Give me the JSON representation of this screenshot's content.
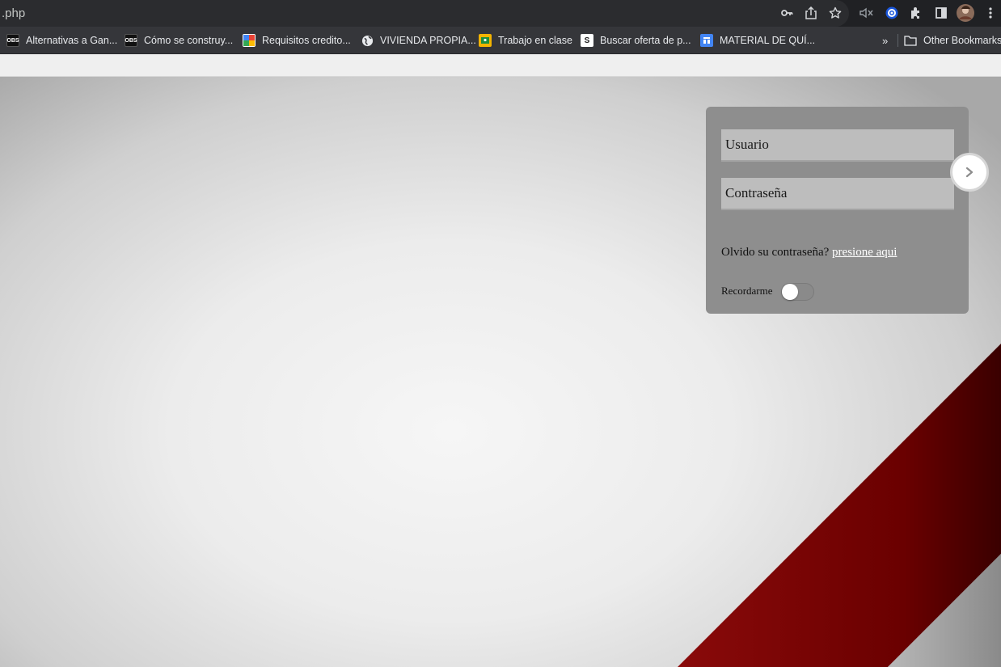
{
  "browser": {
    "url": ".php",
    "toolbar_icons": [
      "key-icon",
      "share-icon",
      "star-icon",
      "mute-icon",
      "extension-blue-icon",
      "puzzle-icon",
      "side-panel-icon",
      "avatar",
      "menu-icon"
    ],
    "bookmarks": [
      {
        "label": "Alternativas a Gan...",
        "icon": "obs-icon",
        "color": "#111111"
      },
      {
        "label": "Cómo se construy...",
        "icon": "obs-icon",
        "color": "#111111"
      },
      {
        "label": "Requisitos credito...",
        "icon": "google-icon",
        "color": "#ffffff"
      },
      {
        "label": "VIVIENDA PROPIA...",
        "icon": "globe-icon",
        "color": "#e8eaed"
      },
      {
        "label": "Trabajo en clase",
        "icon": "classroom-icon",
        "color": "#f4b400"
      },
      {
        "label": "Buscar oferta de p...",
        "icon": "sp-icon",
        "color": "#ffffff"
      },
      {
        "label": "MATERIAL DE QUÍ...",
        "icon": "doc-icon",
        "color": "#4285f4"
      }
    ],
    "more_label": "»",
    "other_bookmarks": "Other Bookmarks"
  },
  "login": {
    "user_placeholder": "Usuario",
    "password_placeholder": "Contraseña",
    "forgot_text": "Olvido su contraseña?",
    "forgot_link": "presione aqui",
    "remember_label": "Recordarme",
    "remember_on": false,
    "next_icon": "chevron-right-icon"
  },
  "colors": {
    "panel": "#8e8e8e",
    "field": "#bdbdbd",
    "stripe": "#7a0000"
  }
}
